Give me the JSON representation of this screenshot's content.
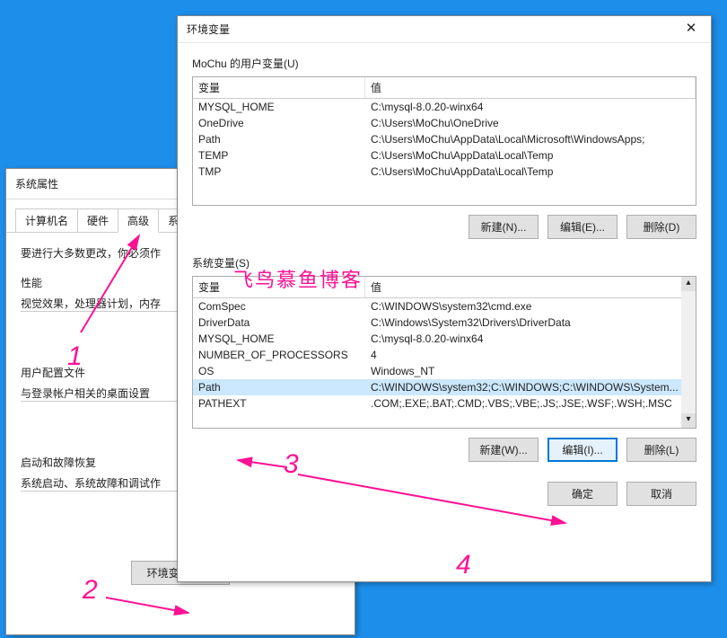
{
  "sysprops": {
    "title": "系统属性",
    "tabs": [
      "计算机名",
      "硬件",
      "高级",
      "系"
    ],
    "active_tab": 2,
    "notice": "要进行大多数更改，你必须作",
    "perf_label": "性能",
    "perf_text": "视觉效果，处理器计划，内存",
    "userprof_label": "用户配置文件",
    "userprof_text": "与登录帐户相关的桌面设置",
    "startup_label": "启动和故障恢复",
    "startup_text": "系统启动、系统故障和调试作",
    "envbtn": "环境变量(N)..."
  },
  "envdlg": {
    "title": "环境变量",
    "close": "✕",
    "user_group_title": "MoChu 的用户变量(U)",
    "sys_group_title": "系统变量(S)",
    "col_name": "变量",
    "col_value": "值",
    "user_vars": [
      {
        "name": "MYSQL_HOME",
        "value": "C:\\mysql-8.0.20-winx64"
      },
      {
        "name": "OneDrive",
        "value": "C:\\Users\\MoChu\\OneDrive"
      },
      {
        "name": "Path",
        "value": "C:\\Users\\MoChu\\AppData\\Local\\Microsoft\\WindowsApps;"
      },
      {
        "name": "TEMP",
        "value": "C:\\Users\\MoChu\\AppData\\Local\\Temp"
      },
      {
        "name": "TMP",
        "value": "C:\\Users\\MoChu\\AppData\\Local\\Temp"
      }
    ],
    "sys_vars": [
      {
        "name": "ComSpec",
        "value": "C:\\WINDOWS\\system32\\cmd.exe"
      },
      {
        "name": "DriverData",
        "value": "C:\\Windows\\System32\\Drivers\\DriverData"
      },
      {
        "name": "MYSQL_HOME",
        "value": "C:\\mysql-8.0.20-winx64"
      },
      {
        "name": "NUMBER_OF_PROCESSORS",
        "value": "4"
      },
      {
        "name": "OS",
        "value": "Windows_NT"
      },
      {
        "name": "Path",
        "value": "C:\\WINDOWS\\system32;C:\\WINDOWS;C:\\WINDOWS\\System...",
        "selected": true
      },
      {
        "name": "PATHEXT",
        "value": ".COM;.EXE;.BAT;.CMD;.VBS;.VBE;.JS;.JSE;.WSF;.WSH;.MSC"
      }
    ],
    "sys_selected_index": 5,
    "btn_new_u": "新建(N)...",
    "btn_edit_u": "编辑(E)...",
    "btn_del_u": "删除(D)",
    "btn_new_s": "新建(W)...",
    "btn_edit_s": "编辑(I)...",
    "btn_del_s": "删除(L)",
    "btn_ok": "确定",
    "btn_cancel": "取消"
  },
  "watermark": "飞鸟慕鱼博客",
  "annotations": {
    "n1": "1",
    "n2": "2",
    "n3": "3",
    "n4": "4"
  }
}
